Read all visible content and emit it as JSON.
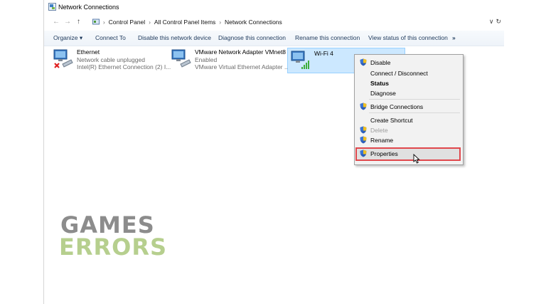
{
  "window": {
    "title": "Network Connections"
  },
  "address": {
    "back": "←",
    "forward": "→",
    "up": "↑",
    "crumbs": [
      "Control Panel",
      "All Control Panel Items",
      "Network Connections"
    ],
    "dropdown": "∨",
    "refresh": "↻"
  },
  "toolbar": {
    "organize": "Organize ▾",
    "connect_to": "Connect To",
    "disable": "Disable this network device",
    "diagnose": "Diagnose this connection",
    "rename": "Rename this connection",
    "view_status": "View status of this connection",
    "more": "»"
  },
  "connections": [
    {
      "name": "Ethernet",
      "status": "Network cable unplugged",
      "device": "Intel(R) Ethernet Connection (2) I..."
    },
    {
      "name": "VMware Network Adapter VMnet8",
      "status": "Enabled",
      "device": "VMware Virtual Ethernet Adapter ..."
    },
    {
      "name": "Wi-Fi 4"
    }
  ],
  "context_menu": {
    "items": [
      {
        "label": "Disable"
      },
      {
        "label": "Connect / Disconnect"
      },
      {
        "label": "Status"
      },
      {
        "label": "Diagnose"
      },
      {
        "label": "Bridge Connections"
      },
      {
        "label": "Create Shortcut"
      },
      {
        "label": "Delete"
      },
      {
        "label": "Rename"
      },
      {
        "label": "Properties"
      }
    ]
  },
  "watermark": {
    "line1": "GAMES",
    "line2": "ERRORS"
  },
  "colors": {
    "highlight_border": "#e0474c",
    "selection": "#cce8ff",
    "toolbar_text": "#1e395b",
    "logo_green": "#b6cf8e"
  }
}
